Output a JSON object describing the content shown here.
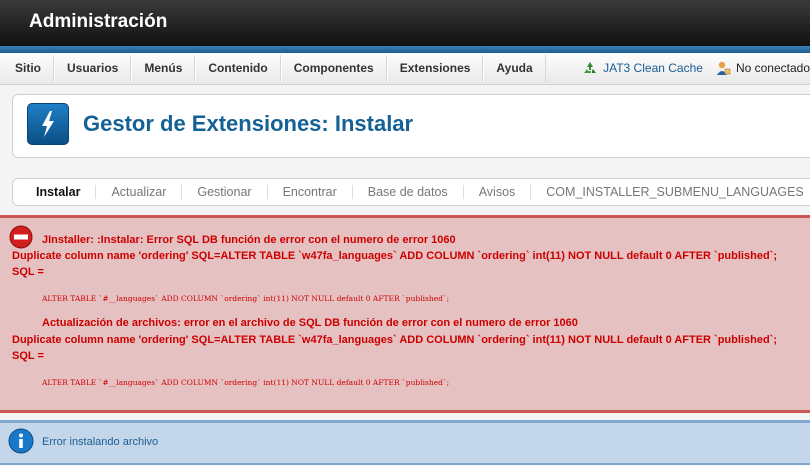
{
  "header": {
    "title": "Administración"
  },
  "menu": {
    "items": [
      "Sitio",
      "Usuarios",
      "Menús",
      "Contenido",
      "Componentes",
      "Extensiones",
      "Ayuda"
    ]
  },
  "status": {
    "cache_label": "JAT3 Clean Cache",
    "user_label": "No conectado"
  },
  "toolbar": {
    "title": "Gestor de Extensiones: Instalar"
  },
  "submenu": {
    "tabs": [
      "Instalar",
      "Actualizar",
      "Gestionar",
      "Encontrar",
      "Base de datos",
      "Avisos",
      "COM_INSTALLER_SUBMENU_LANGUAGES"
    ],
    "active": "Instalar"
  },
  "messages": {
    "error": {
      "head1": "JInstaller: :Instalar: Error SQL DB función de error con el numero de error 1060",
      "body1": "Duplicate column name 'ordering' SQL=ALTER TABLE `w47fa_languages` ADD COLUMN `ordering` int(11) NOT NULL default 0 AFTER `published`; SQL =",
      "code1": "ALTER TABLE `#__languages` ADD COLUMN `ordering` int(11) NOT NULL default 0 AFTER `published`;",
      "head2": "Actualización de archivos: error en el archivo de SQL DB función de error con el numero de error 1060",
      "body2": "Duplicate column name 'ordering' SQL=ALTER TABLE `w47fa_languages` ADD COLUMN `ordering` int(11) NOT NULL default 0 AFTER `published`; SQL =",
      "code2": "ALTER TABLE `#__languages` ADD COLUMN `ordering` int(11) NOT NULL default 0 AFTER `published`;"
    },
    "info": {
      "text": "Error instalando archivo"
    }
  }
}
